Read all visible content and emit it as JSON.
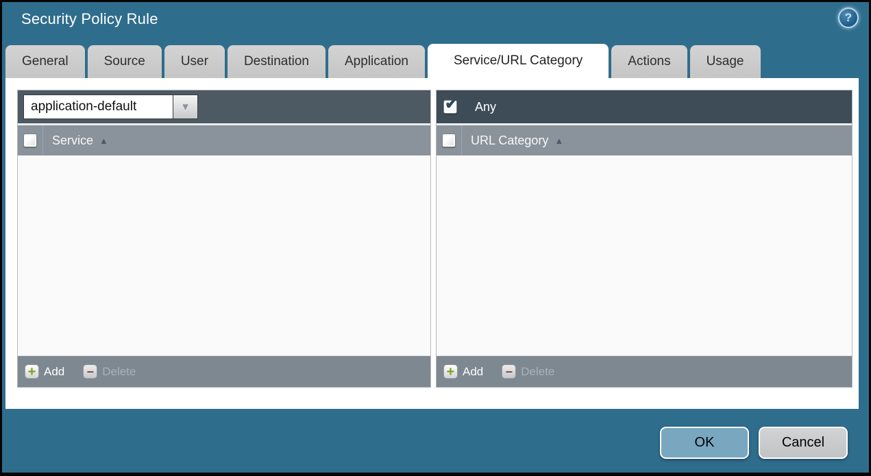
{
  "window": {
    "title": "Security Policy Rule"
  },
  "icons": {
    "help": "?",
    "sort_ascending": "▲",
    "dropdown_arrow": "▼",
    "checkmark": "✔",
    "add_plus": "+",
    "delete_minus": "−"
  },
  "tabs": {
    "items": [
      {
        "label": "General",
        "active": false
      },
      {
        "label": "Source",
        "active": false
      },
      {
        "label": "User",
        "active": false
      },
      {
        "label": "Destination",
        "active": false
      },
      {
        "label": "Application",
        "active": false
      },
      {
        "label": "Service/URL Category",
        "active": true
      },
      {
        "label": "Actions",
        "active": false
      },
      {
        "label": "Usage",
        "active": false
      }
    ]
  },
  "service_panel": {
    "dropdown_value": "application-default",
    "column_header": "Service",
    "rows": [],
    "add_label": "Add",
    "delete_label": "Delete",
    "delete_enabled": false
  },
  "url_category_panel": {
    "any_label": "Any",
    "any_checked": true,
    "column_header": "URL Category",
    "rows": [],
    "add_label": "Add",
    "delete_label": "Delete",
    "delete_enabled": false
  },
  "action_buttons": {
    "ok": "OK",
    "cancel": "Cancel"
  },
  "colors": {
    "background": "#2f6d8d",
    "ok_button": "#78a7bf",
    "cancel_button": "#c9cacc",
    "add_green": "#7ea11d",
    "delete_red": "#8a3a30",
    "any_bar": "#3e4c58",
    "service_bar": "#4d5963",
    "header_row": "#8a939b",
    "footer_bar": "#7e8890",
    "active_tab": "#ffffff",
    "inactive_tab": "#c9c9c9"
  }
}
